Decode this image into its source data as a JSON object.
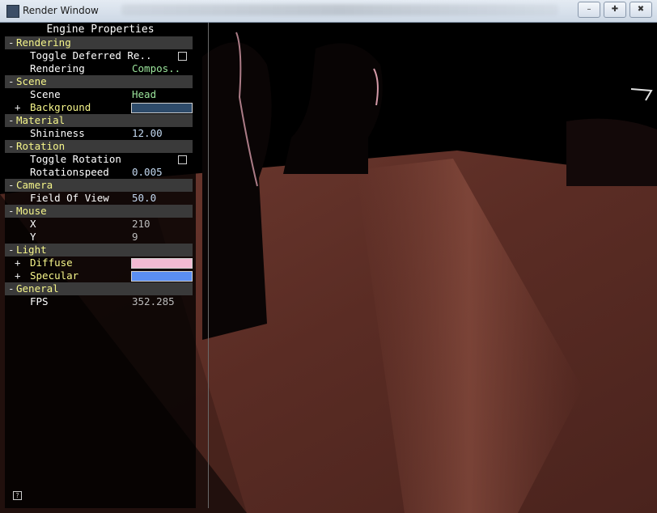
{
  "window": {
    "title": "Render Window",
    "buttons": [
      "–",
      "✚",
      "✖"
    ]
  },
  "panel": {
    "title": "Engine Properties",
    "help_label": "?",
    "groups": [
      {
        "name": "Rendering",
        "items": [
          {
            "label": "Toggle Deferred Re..",
            "kind": "checkbox"
          },
          {
            "label": "Rendering",
            "kind": "value",
            "value": "Compos..",
            "value_color": "green"
          }
        ]
      },
      {
        "name": "Scene",
        "items": [
          {
            "label": "Scene",
            "kind": "value",
            "value": "Head",
            "value_color": "green"
          },
          {
            "label": "Background",
            "kind": "color",
            "expandable": true,
            "color": "#2e4b6a"
          }
        ]
      },
      {
        "name": "Material",
        "items": [
          {
            "label": "Shininess",
            "kind": "value",
            "value": "12.00",
            "value_color": "blue"
          }
        ]
      },
      {
        "name": "Rotation",
        "items": [
          {
            "label": "Toggle Rotation",
            "kind": "checkbox"
          },
          {
            "label": "Rotationspeed",
            "kind": "value",
            "value": "0.005",
            "value_color": "blue"
          }
        ]
      },
      {
        "name": "Camera",
        "items": [
          {
            "label": "Field Of View",
            "kind": "value",
            "value": "50.0",
            "value_color": "blue"
          }
        ]
      },
      {
        "name": "Mouse",
        "items": [
          {
            "label": "X",
            "kind": "value",
            "value": "210",
            "value_color": "gray"
          },
          {
            "label": "Y",
            "kind": "value",
            "value": "9",
            "value_color": "gray"
          }
        ]
      },
      {
        "name": "Light",
        "items": [
          {
            "label": "Diffuse",
            "kind": "color",
            "expandable": true,
            "color": "#f2bad2"
          },
          {
            "label": "Specular",
            "kind": "color",
            "expandable": true,
            "color": "#5a8ef2"
          }
        ]
      },
      {
        "name": "General",
        "items": [
          {
            "label": "FPS",
            "kind": "value",
            "value": "352.285",
            "value_color": "gray"
          }
        ]
      }
    ]
  }
}
